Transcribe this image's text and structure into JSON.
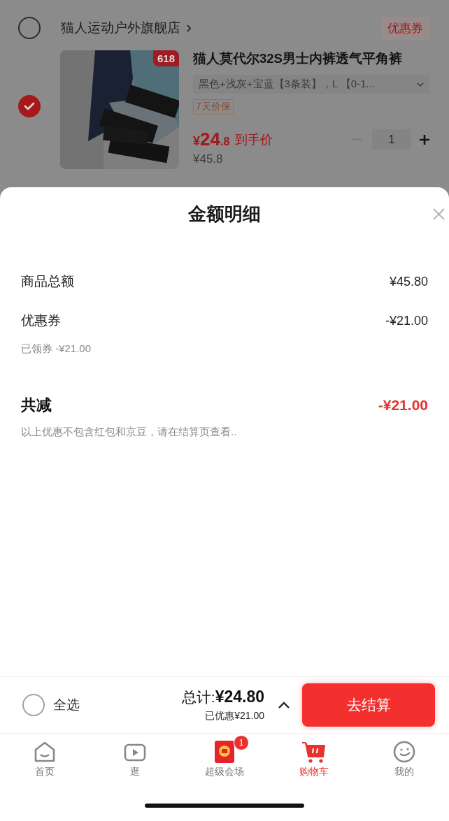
{
  "store": {
    "name": "猫人运动户外旗舰店",
    "selected": false,
    "coupon_label": "优惠券"
  },
  "item": {
    "selected": true,
    "badge": "618",
    "title": "猫人莫代尔32S男士内裤透气平角裤",
    "variant": "黑色+浅灰+宝蓝【3条装】，L 【0-1...",
    "tag": "7天价保",
    "currency": "¥",
    "price_int": "24",
    "price_dec": ".8",
    "price_label": "到手价",
    "original_price": "¥45.8",
    "quantity": "1",
    "minus_disabled": true
  },
  "sheet": {
    "title": "金额明细",
    "rows": [
      {
        "label": "商品总额",
        "value": "¥45.80"
      },
      {
        "label": "优惠券",
        "value": "-¥21.00"
      }
    ],
    "coupon_note": "已领券 -¥21.00",
    "total": {
      "label": "共减",
      "value": "-¥21.00"
    },
    "note": "以上优惠不包含红包和京豆，请在结算页查看.."
  },
  "checkout_bar": {
    "select_all": {
      "label": "全选",
      "checked": false
    },
    "total_label": "总计:",
    "total": "¥24.80",
    "discount": "已优惠¥21.00",
    "button": "去结算"
  },
  "tabs": [
    {
      "kind": "home",
      "label": "首页",
      "selected": false
    },
    {
      "kind": "video",
      "label": "逛",
      "selected": false
    },
    {
      "kind": "redpacket",
      "label": "超级会场",
      "selected": false,
      "badge": "1"
    },
    {
      "kind": "cart",
      "label": "购物车",
      "selected": true
    },
    {
      "kind": "smile",
      "label": "我的",
      "selected": false
    }
  ]
}
